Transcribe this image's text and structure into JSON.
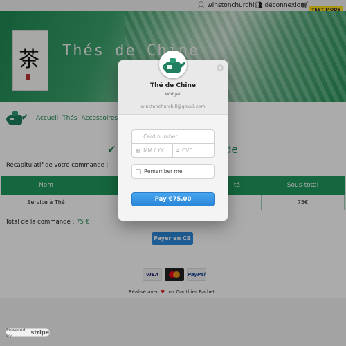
{
  "topbar": {
    "username": "winstonchurchill",
    "logout": "déconnexion",
    "test_mode": "TEST MODE"
  },
  "banner": {
    "title": "Thés de Chine",
    "logo_glyph": "茶"
  },
  "nav": {
    "links": [
      "Accueil",
      "Thés",
      "Accessoires"
    ]
  },
  "confirmation": {
    "title_tail": "de"
  },
  "recap_label": "Récapitulatif de votre commande :",
  "order_table": {
    "headers": [
      "Nom",
      "",
      "ité",
      "Sous-total"
    ],
    "rows": [
      [
        "Service à Thé",
        "",
        "",
        "75€"
      ]
    ]
  },
  "total": {
    "label": "Total de la commande :",
    "amount": "75 €"
  },
  "pay_cb_label": "Payer en CB",
  "payment_cards": [
    "VISA",
    "mastercard",
    "PayPal"
  ],
  "credit": {
    "before": "Réalisé avec",
    "after": "par Gauthier Barbet."
  },
  "powered": {
    "prefix": "Powered by",
    "brand": "stripe"
  },
  "checkout": {
    "merchant": "Thé de Chine",
    "subtitle": "Widget",
    "email": "winstonchurchill@gmail.com",
    "card_number_placeholder": "Card number",
    "expiry_placeholder": "MM / YY",
    "cvc_placeholder": "CVC",
    "remember_label": "Remember me",
    "pay_label": "Pay €75.00",
    "close_symbol": "×"
  },
  "colors": {
    "brand_green": "#1f9a5d",
    "pay_blue": "#2a87d8",
    "test_mode_yellow": "#ffe21d"
  }
}
